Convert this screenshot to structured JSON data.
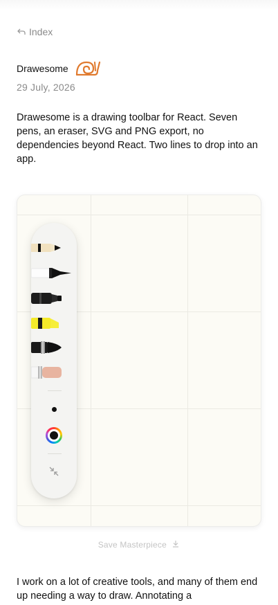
{
  "nav": {
    "back_label": "Index"
  },
  "post": {
    "title": "Drawesome",
    "date": "29 July, 2026",
    "intro": "Drawesome is a drawing toolbar for React. Seven pens, an eraser, SVG and PNG export, no dependencies beyond React. Two lines to drop into an app.",
    "body": "I work on a lot of creative tools, and many of them end up needing a way to draw. Annotating a"
  },
  "toolbar": {
    "tools": [
      "pencil",
      "fountain-pen",
      "marker",
      "highlighter",
      "brush-pen",
      "eraser"
    ],
    "selected_color": "#111111"
  },
  "actions": {
    "save_label": "Save Masterpiece"
  },
  "colors": {
    "accent_snail": "#e07a2e",
    "canvas_bg": "#fcfbf5",
    "highlighter": "#f4ea2a",
    "eraser": "#e8b4a0"
  }
}
